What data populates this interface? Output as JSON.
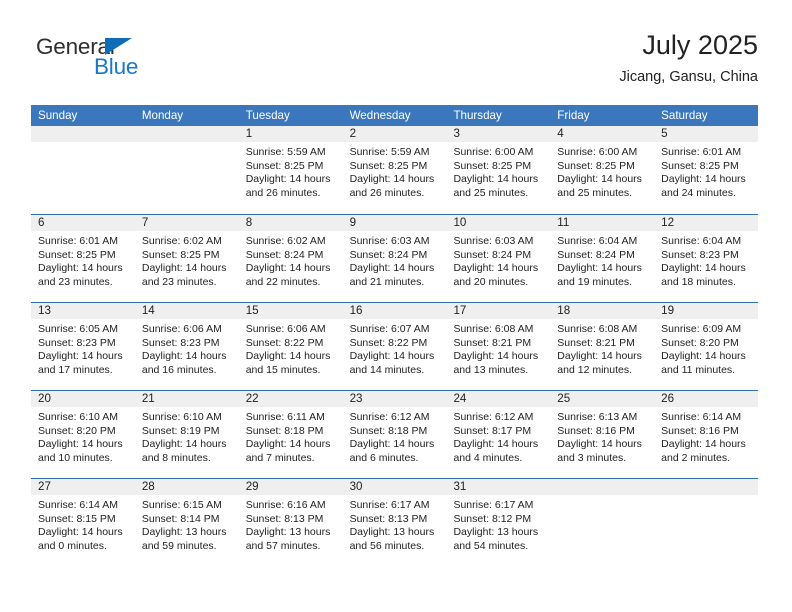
{
  "brand": {
    "name_top": "General",
    "name_bottom": "Blue",
    "colors": {
      "triangle": "#0f6cb8",
      "blue_text": "#1878c8",
      "dark_text": "#2f2f2f"
    }
  },
  "header": {
    "title": "July 2025",
    "location": "Jicang, Gansu, China"
  },
  "calendar": {
    "colors": {
      "header_bg": "#3b77bd",
      "header_text": "#ffffff",
      "date_band": "#efefef",
      "week_rule": "#2e6ead"
    },
    "day_names": [
      "Sunday",
      "Monday",
      "Tuesday",
      "Wednesday",
      "Thursday",
      "Friday",
      "Saturday"
    ],
    "weeks": [
      [
        {
          "day": ""
        },
        {
          "day": ""
        },
        {
          "day": "1",
          "sunrise": "Sunrise: 5:59 AM",
          "sunset": "Sunset: 8:25 PM",
          "daylight": "Daylight: 14 hours and 26 minutes."
        },
        {
          "day": "2",
          "sunrise": "Sunrise: 5:59 AM",
          "sunset": "Sunset: 8:25 PM",
          "daylight": "Daylight: 14 hours and 26 minutes."
        },
        {
          "day": "3",
          "sunrise": "Sunrise: 6:00 AM",
          "sunset": "Sunset: 8:25 PM",
          "daylight": "Daylight: 14 hours and 25 minutes."
        },
        {
          "day": "4",
          "sunrise": "Sunrise: 6:00 AM",
          "sunset": "Sunset: 8:25 PM",
          "daylight": "Daylight: 14 hours and 25 minutes."
        },
        {
          "day": "5",
          "sunrise": "Sunrise: 6:01 AM",
          "sunset": "Sunset: 8:25 PM",
          "daylight": "Daylight: 14 hours and 24 minutes."
        }
      ],
      [
        {
          "day": "6",
          "sunrise": "Sunrise: 6:01 AM",
          "sunset": "Sunset: 8:25 PM",
          "daylight": "Daylight: 14 hours and 23 minutes."
        },
        {
          "day": "7",
          "sunrise": "Sunrise: 6:02 AM",
          "sunset": "Sunset: 8:25 PM",
          "daylight": "Daylight: 14 hours and 23 minutes."
        },
        {
          "day": "8",
          "sunrise": "Sunrise: 6:02 AM",
          "sunset": "Sunset: 8:24 PM",
          "daylight": "Daylight: 14 hours and 22 minutes."
        },
        {
          "day": "9",
          "sunrise": "Sunrise: 6:03 AM",
          "sunset": "Sunset: 8:24 PM",
          "daylight": "Daylight: 14 hours and 21 minutes."
        },
        {
          "day": "10",
          "sunrise": "Sunrise: 6:03 AM",
          "sunset": "Sunset: 8:24 PM",
          "daylight": "Daylight: 14 hours and 20 minutes."
        },
        {
          "day": "11",
          "sunrise": "Sunrise: 6:04 AM",
          "sunset": "Sunset: 8:24 PM",
          "daylight": "Daylight: 14 hours and 19 minutes."
        },
        {
          "day": "12",
          "sunrise": "Sunrise: 6:04 AM",
          "sunset": "Sunset: 8:23 PM",
          "daylight": "Daylight: 14 hours and 18 minutes."
        }
      ],
      [
        {
          "day": "13",
          "sunrise": "Sunrise: 6:05 AM",
          "sunset": "Sunset: 8:23 PM",
          "daylight": "Daylight: 14 hours and 17 minutes."
        },
        {
          "day": "14",
          "sunrise": "Sunrise: 6:06 AM",
          "sunset": "Sunset: 8:23 PM",
          "daylight": "Daylight: 14 hours and 16 minutes."
        },
        {
          "day": "15",
          "sunrise": "Sunrise: 6:06 AM",
          "sunset": "Sunset: 8:22 PM",
          "daylight": "Daylight: 14 hours and 15 minutes."
        },
        {
          "day": "16",
          "sunrise": "Sunrise: 6:07 AM",
          "sunset": "Sunset: 8:22 PM",
          "daylight": "Daylight: 14 hours and 14 minutes."
        },
        {
          "day": "17",
          "sunrise": "Sunrise: 6:08 AM",
          "sunset": "Sunset: 8:21 PM",
          "daylight": "Daylight: 14 hours and 13 minutes."
        },
        {
          "day": "18",
          "sunrise": "Sunrise: 6:08 AM",
          "sunset": "Sunset: 8:21 PM",
          "daylight": "Daylight: 14 hours and 12 minutes."
        },
        {
          "day": "19",
          "sunrise": "Sunrise: 6:09 AM",
          "sunset": "Sunset: 8:20 PM",
          "daylight": "Daylight: 14 hours and 11 minutes."
        }
      ],
      [
        {
          "day": "20",
          "sunrise": "Sunrise: 6:10 AM",
          "sunset": "Sunset: 8:20 PM",
          "daylight": "Daylight: 14 hours and 10 minutes."
        },
        {
          "day": "21",
          "sunrise": "Sunrise: 6:10 AM",
          "sunset": "Sunset: 8:19 PM",
          "daylight": "Daylight: 14 hours and 8 minutes."
        },
        {
          "day": "22",
          "sunrise": "Sunrise: 6:11 AM",
          "sunset": "Sunset: 8:18 PM",
          "daylight": "Daylight: 14 hours and 7 minutes."
        },
        {
          "day": "23",
          "sunrise": "Sunrise: 6:12 AM",
          "sunset": "Sunset: 8:18 PM",
          "daylight": "Daylight: 14 hours and 6 minutes."
        },
        {
          "day": "24",
          "sunrise": "Sunrise: 6:12 AM",
          "sunset": "Sunset: 8:17 PM",
          "daylight": "Daylight: 14 hours and 4 minutes."
        },
        {
          "day": "25",
          "sunrise": "Sunrise: 6:13 AM",
          "sunset": "Sunset: 8:16 PM",
          "daylight": "Daylight: 14 hours and 3 minutes."
        },
        {
          "day": "26",
          "sunrise": "Sunrise: 6:14 AM",
          "sunset": "Sunset: 8:16 PM",
          "daylight": "Daylight: 14 hours and 2 minutes."
        }
      ],
      [
        {
          "day": "27",
          "sunrise": "Sunrise: 6:14 AM",
          "sunset": "Sunset: 8:15 PM",
          "daylight": "Daylight: 14 hours and 0 minutes."
        },
        {
          "day": "28",
          "sunrise": "Sunrise: 6:15 AM",
          "sunset": "Sunset: 8:14 PM",
          "daylight": "Daylight: 13 hours and 59 minutes."
        },
        {
          "day": "29",
          "sunrise": "Sunrise: 6:16 AM",
          "sunset": "Sunset: 8:13 PM",
          "daylight": "Daylight: 13 hours and 57 minutes."
        },
        {
          "day": "30",
          "sunrise": "Sunrise: 6:17 AM",
          "sunset": "Sunset: 8:13 PM",
          "daylight": "Daylight: 13 hours and 56 minutes."
        },
        {
          "day": "31",
          "sunrise": "Sunrise: 6:17 AM",
          "sunset": "Sunset: 8:12 PM",
          "daylight": "Daylight: 13 hours and 54 minutes."
        },
        {
          "day": ""
        },
        {
          "day": ""
        }
      ]
    ]
  }
}
